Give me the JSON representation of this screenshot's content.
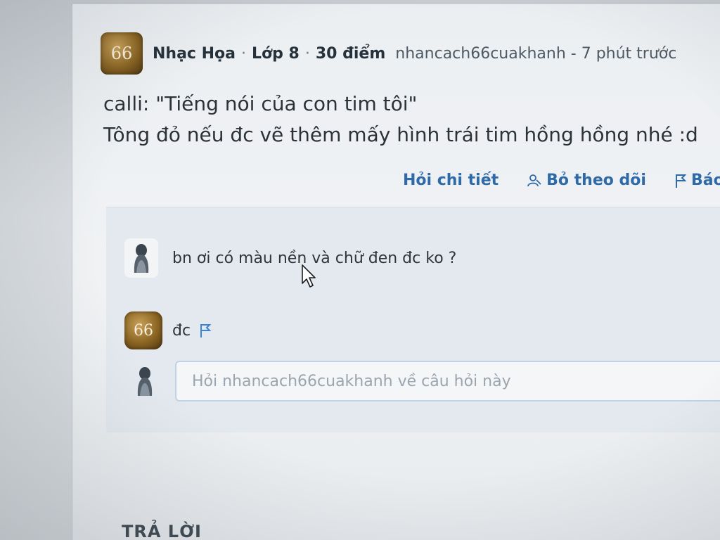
{
  "question_header": {
    "avatar_text": "66",
    "subject": "Nhạc Họa",
    "separator": "·",
    "grade": "Lớp 8",
    "points": "30 điểm",
    "user_and_time": "nhancach66cuakhanh - 7 phút trước"
  },
  "question": {
    "line1": "calli: \"Tiếng nói của con tim tôi\"",
    "line2": "Tông đỏ nếu đc vẽ thêm mấy hình trái tim hồng hồng nhé :d"
  },
  "actions": {
    "ask_detail": "Hỏi chi tiết",
    "unfollow": "Bỏ theo dõi",
    "report": "Báo cáo"
  },
  "comments": [
    {
      "text": "bn ơi có màu nền và chữ đen đc ko ?"
    },
    {
      "avatar_text": "66",
      "text": "đc"
    }
  ],
  "reply": {
    "placeholder": "Hỏi nhancach66cuakhanh về câu hỏi này"
  },
  "answers_heading": "TRẢ LỜI",
  "colors": {
    "accent": "#2f6aa8",
    "avatar_gold": "#8a6422"
  }
}
